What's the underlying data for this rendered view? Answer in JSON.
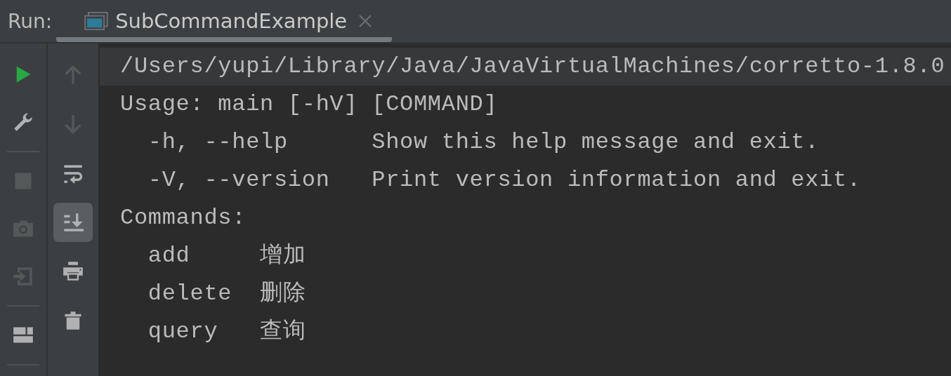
{
  "run_label": "Run:",
  "tabs": [
    {
      "label": "SubCommandExample",
      "selected": true
    }
  ],
  "left_toolbar": [
    {
      "kind": "run",
      "disabled": false,
      "selected": false
    },
    {
      "kind": "wrench",
      "disabled": false,
      "selected": false
    },
    {
      "kind": "separator"
    },
    {
      "kind": "stop",
      "disabled": true,
      "selected": false
    },
    {
      "kind": "camera",
      "disabled": true,
      "selected": false
    },
    {
      "kind": "exit",
      "disabled": true,
      "selected": false
    },
    {
      "kind": "separator"
    },
    {
      "kind": "layout",
      "disabled": false,
      "selected": false
    },
    {
      "kind": "separator"
    }
  ],
  "right_toolbar": [
    {
      "kind": "up",
      "disabled": true,
      "selected": false
    },
    {
      "kind": "down",
      "disabled": true,
      "selected": false
    },
    {
      "kind": "wrap",
      "disabled": false,
      "selected": false
    },
    {
      "kind": "scroll-end",
      "disabled": false,
      "selected": true
    },
    {
      "kind": "print",
      "disabled": false,
      "selected": false
    },
    {
      "kind": "trash",
      "disabled": false,
      "selected": false
    }
  ],
  "console_lines": [
    {
      "text": "/Users/yupi/Library/Java/JavaVirtualMachines/corretto-1.8.0",
      "highlighted": true
    },
    {
      "text": "Usage: main [-hV] [COMMAND]",
      "highlighted": false
    },
    {
      "text": "  -h, --help      Show this help message and exit.",
      "highlighted": false
    },
    {
      "text": "  -V, --version   Print version information and exit.",
      "highlighted": false
    },
    {
      "text": "Commands:",
      "highlighted": false
    },
    {
      "text": "  add     增加",
      "highlighted": false
    },
    {
      "text": "  delete  删除",
      "highlighted": false
    },
    {
      "text": "  query   查询",
      "highlighted": false
    }
  ]
}
